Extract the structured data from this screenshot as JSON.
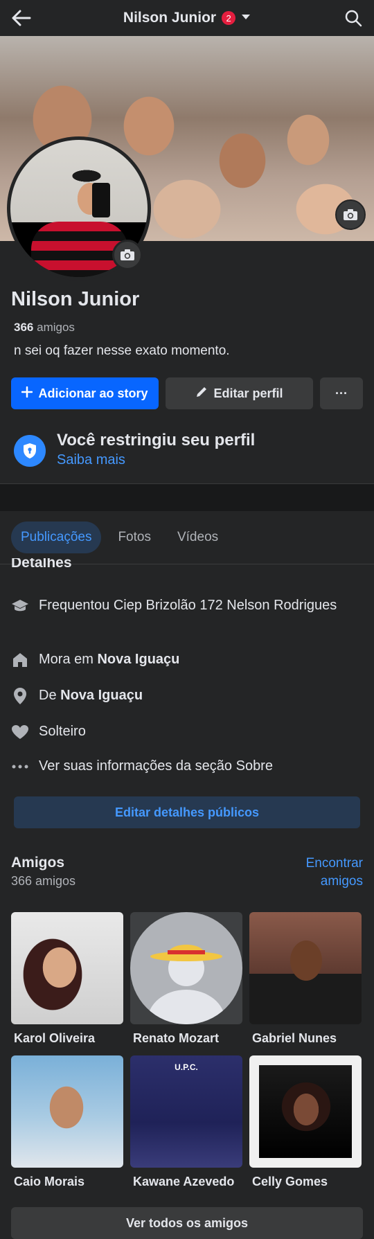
{
  "header": {
    "title": "Nilson Junior",
    "notification_count": "2"
  },
  "profile": {
    "name": "Nilson Junior",
    "friends_count": "366",
    "friends_word": "amigos",
    "bio": "n sei oq fazer nesse exato momento."
  },
  "actions": {
    "add_story": "Adicionar ao story",
    "edit_profile": "Editar perfil",
    "more": "···"
  },
  "restriction": {
    "title": "Você restringiu seu perfil",
    "link": "Saiba mais"
  },
  "tabs": [
    {
      "label": "Publicações",
      "active": true
    },
    {
      "label": "Fotos",
      "active": false
    },
    {
      "label": "Vídeos",
      "active": false
    }
  ],
  "details": {
    "heading": "Detalhes",
    "studied": "Frequentou Ciep Brizolão 172 Nelson Rodrigues",
    "lives_prefix": "Mora em",
    "lives_city": "Nova Iguaçu",
    "from_prefix": "De",
    "from_city": "Nova Iguaçu",
    "relationship": "Solteiro",
    "see_about": "Ver suas informações da seção Sobre",
    "edit_public": "Editar detalhes públicos"
  },
  "friends": {
    "title": "Amigos",
    "subtitle": "366 amigos",
    "find_link": "Encontrar amigos",
    "list": [
      {
        "name": "Karol Oliveira"
      },
      {
        "name": "Renato Mozart"
      },
      {
        "name": "Gabriel Nunes"
      },
      {
        "name": "Caio Morais"
      },
      {
        "name": "Kawane Azevedo"
      },
      {
        "name": "Celly Gomes"
      }
    ],
    "banner_text": "U.P.C.",
    "see_all": "Ver todos os amigos"
  },
  "colors": {
    "accent": "#0866ff",
    "link": "#4599ff",
    "background": "#242526"
  }
}
